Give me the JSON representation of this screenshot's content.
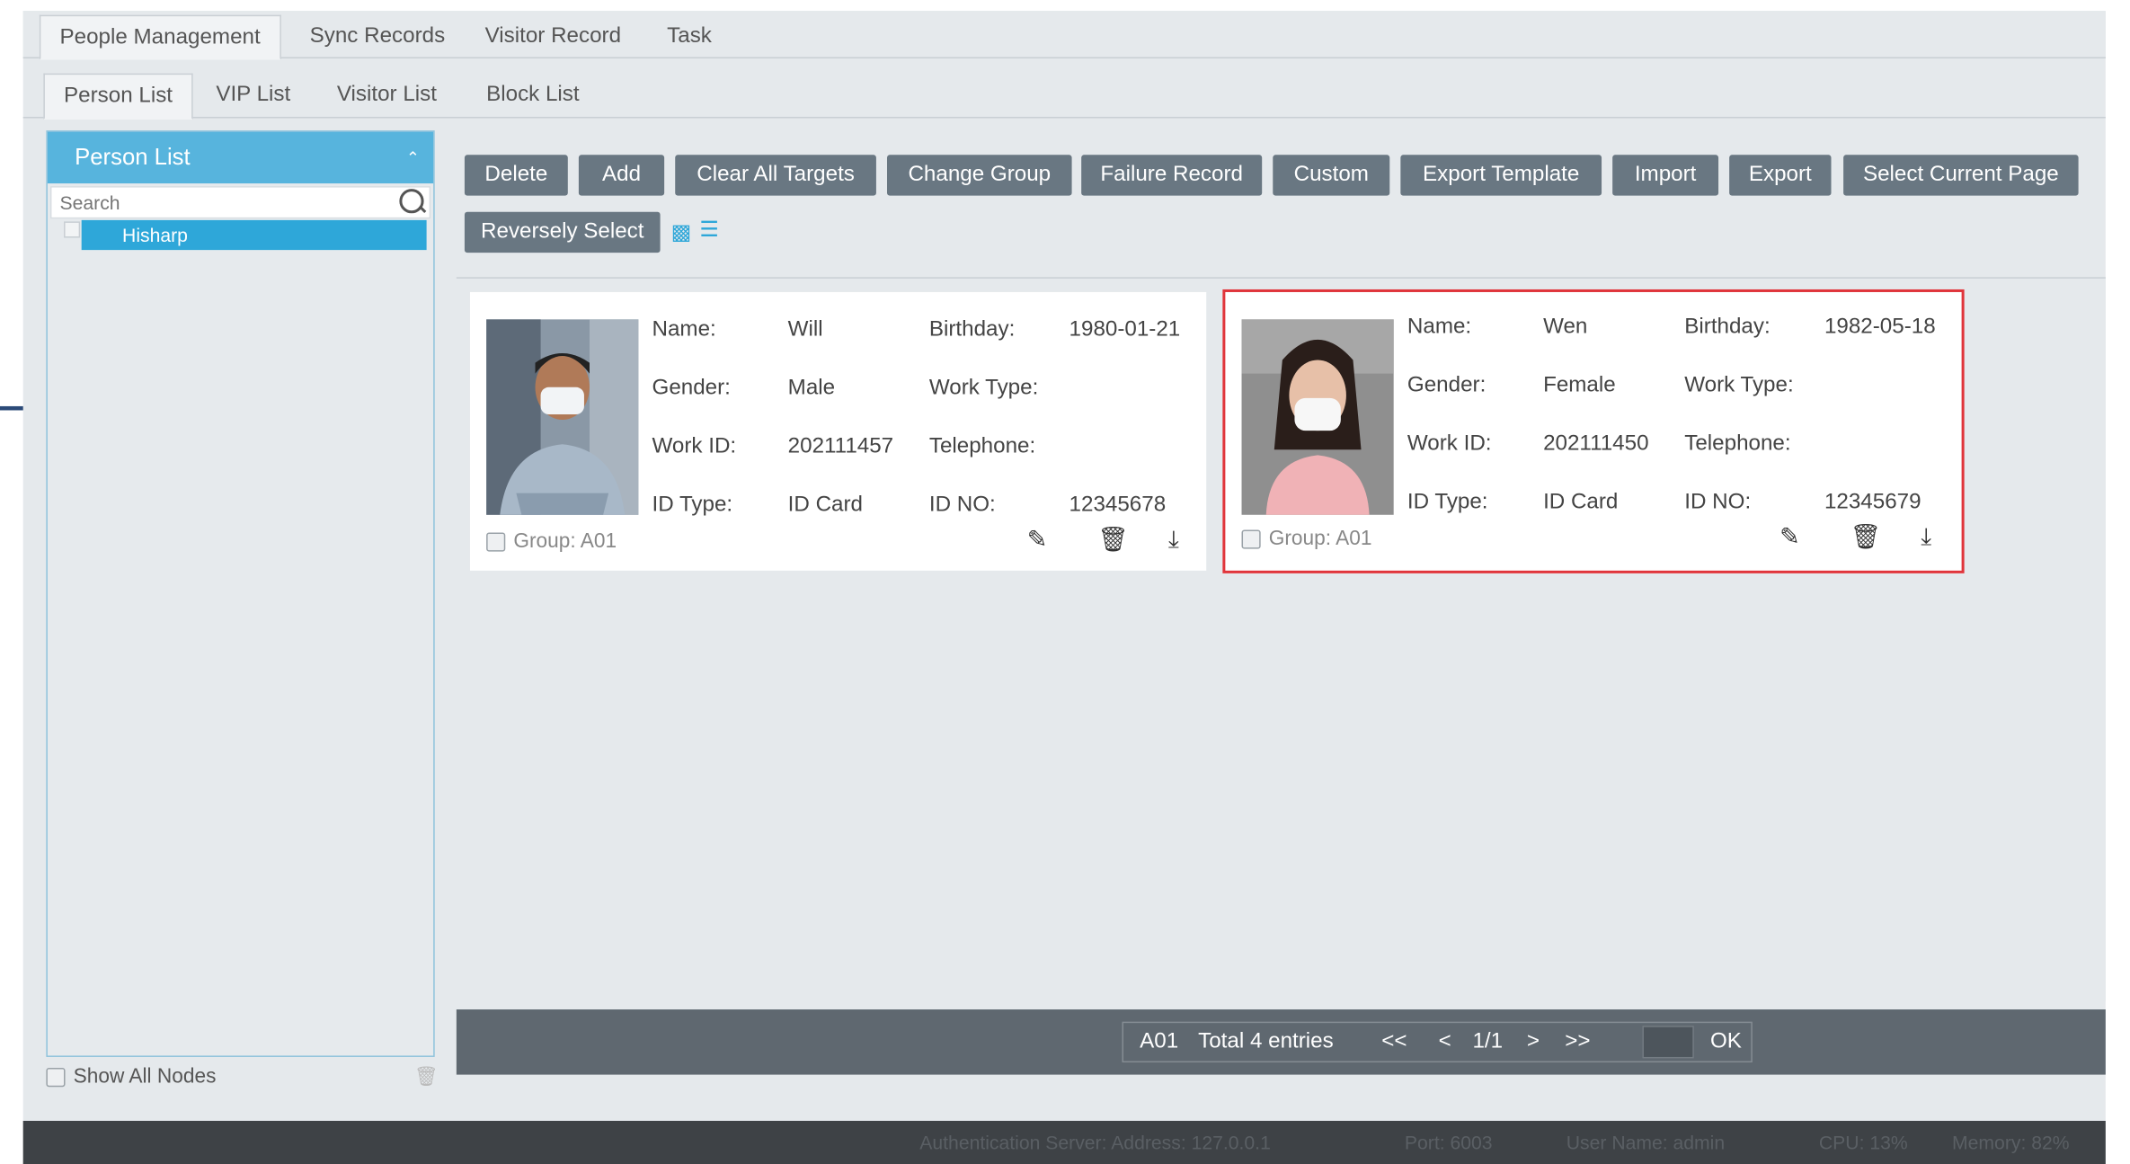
{
  "outer_tabs": [
    "People Management",
    "Sync Records",
    "Visitor Record",
    "Task"
  ],
  "inner_tabs": [
    "Person List",
    "VIP List",
    "Visitor List",
    "Block List"
  ],
  "sidebar": {
    "title": "Person List",
    "search_placeholder": "Search",
    "tree_node": "Hisharp",
    "show_all_nodes": "Show All Nodes"
  },
  "toolbar": {
    "buttons": [
      "Delete",
      "Add",
      "Clear All Targets",
      "Change Group",
      "Failure Record",
      "Custom",
      "Export Template",
      "Import",
      "Export",
      "Select Current Page",
      "Reversely Select"
    ]
  },
  "labels": {
    "name": "Name:",
    "birthday": "Birthday:",
    "gender": "Gender:",
    "work_type": "Work Type:",
    "work_id": "Work ID:",
    "telephone": "Telephone:",
    "id_type": "ID Type:",
    "id_no": "ID NO:"
  },
  "persons": [
    {
      "name": "Will",
      "birthday": "1980-01-21",
      "gender": "Male",
      "work_type": "",
      "work_id": "202111457",
      "telephone": "",
      "id_type": "ID Card",
      "id_no": "12345678",
      "group": "Group: A01",
      "selected": false
    },
    {
      "name": "Wen",
      "birthday": "1982-05-18",
      "gender": "Female",
      "work_type": "",
      "work_id": "202111450",
      "telephone": "",
      "id_type": "ID Card",
      "id_no": "12345679",
      "group": "Group: A01",
      "selected": true
    }
  ],
  "pager": {
    "group": "A01",
    "total": "Total 4 entries",
    "first": "<<",
    "prev": "<",
    "page": "1/1",
    "next": ">",
    "last": ">>",
    "ok": "OK"
  },
  "status": {
    "auth": "Authentication Server: Address: 127.0.0.1",
    "port": "Port: 6003",
    "user": "User Name: admin",
    "cpu": "CPU: 13%",
    "memory": "Memory: 82%"
  },
  "colors": {
    "accent": "#2ea7d9",
    "button": "#697782",
    "selected_border": "#e0353b"
  }
}
